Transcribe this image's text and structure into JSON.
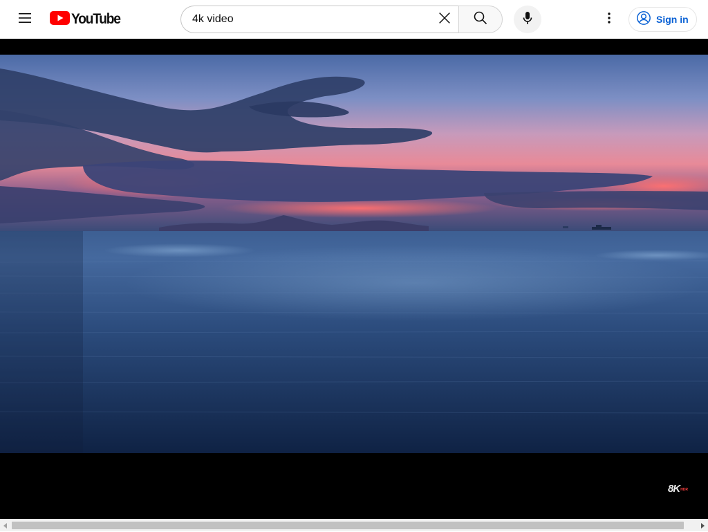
{
  "header": {
    "logo_text": "YouTube",
    "search": {
      "value": "4k video",
      "placeholder": "Search"
    },
    "signin_label": "Sign in",
    "icons": {
      "menu": "hamburger-menu-icon",
      "clear": "close-icon",
      "search": "search-icon",
      "mic": "microphone-icon",
      "more": "more-vertical-icon",
      "account": "account-circle-icon"
    }
  },
  "player": {
    "watermark_main": "8K",
    "watermark_sub": "HDR"
  },
  "colors": {
    "brand_red": "#ff0000",
    "link_blue": "#065fd4",
    "player_bg": "#000000"
  }
}
